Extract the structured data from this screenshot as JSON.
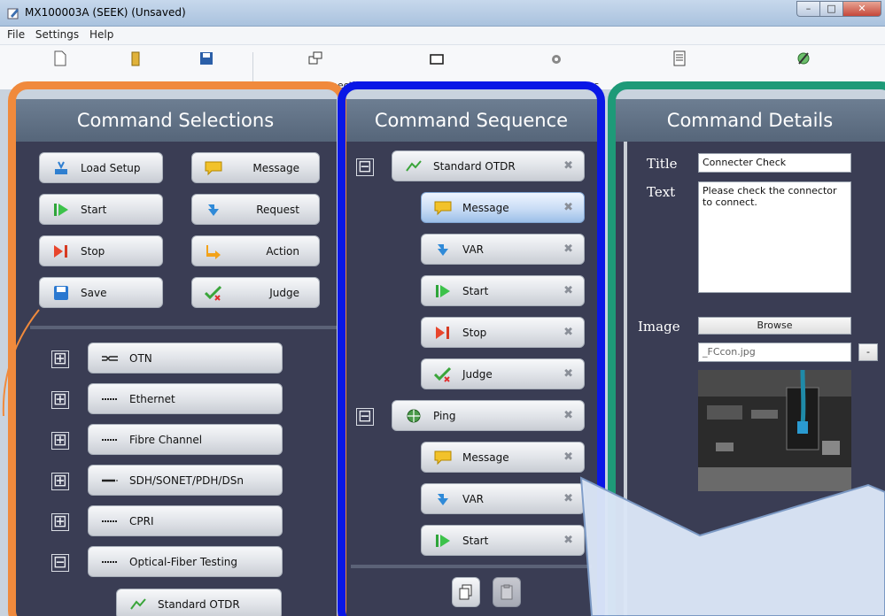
{
  "window": {
    "title": "MX100003A (SEEK) (Unsaved)",
    "min": "–",
    "max": "□",
    "close": "✕"
  },
  "menu": [
    "File",
    "Settings",
    "Help"
  ],
  "toolbar": [
    {
      "label": "New",
      "icon": "new-file-icon"
    },
    {
      "label": "Open",
      "icon": "open-folder-icon"
    },
    {
      "label": "Save",
      "icon": "save-icon"
    },
    {
      "label": "MT1000A Connection",
      "icon": "connection-icon"
    },
    {
      "label": "Instrument Configuration",
      "icon": "instrument-icon"
    },
    {
      "label": "Scenario Settings",
      "icon": "scenario-settings-icon"
    },
    {
      "label": "Report Settings",
      "icon": "report-settings-icon"
    },
    {
      "label": "Global Variables",
      "icon": "global-variables-icon"
    }
  ],
  "selections": {
    "title": "Command Selections",
    "commands": [
      {
        "label": "Load Setup",
        "icon": "load-setup-icon"
      },
      {
        "label": "Message",
        "icon": "message-icon"
      },
      {
        "label": "Start",
        "icon": "start-icon"
      },
      {
        "label": "Request",
        "icon": "request-icon"
      },
      {
        "label": "Stop",
        "icon": "stop-icon"
      },
      {
        "label": "Action",
        "icon": "action-icon"
      },
      {
        "label": "Save",
        "icon": "save-icon"
      },
      {
        "label": "Judge",
        "icon": "judge-icon"
      }
    ],
    "categories": [
      {
        "label": "OTN",
        "expander": "⊞"
      },
      {
        "label": "Ethernet",
        "expander": "⊞"
      },
      {
        "label": "Fibre Channel",
        "expander": "⊞"
      },
      {
        "label": "SDH/SONET/PDH/DSn",
        "expander": "⊞"
      },
      {
        "label": "CPRI",
        "expander": "⊞"
      },
      {
        "label": "Optical-Fiber Testing",
        "expander": "⊟"
      }
    ],
    "sub_item": "Standard OTDR"
  },
  "sequence": {
    "title": "Command Sequence",
    "groups": [
      {
        "label": "Standard OTDR",
        "items": [
          "Message",
          "VAR",
          "Start",
          "Stop",
          "Judge"
        ]
      },
      {
        "label": "Ping",
        "items": [
          "Message",
          "VAR",
          "Start"
        ]
      }
    ],
    "delete_glyph": "✖"
  },
  "details": {
    "title": "Command Details",
    "title_label": "Title",
    "title_value": "Connecter Check",
    "text_label": "Text",
    "text_value": "Please check the connector to connect.",
    "image_label": "Image",
    "browse_label": "Browse",
    "image_file": "_FCcon.jpg",
    "clear_label": "-"
  },
  "colors": {
    "selections_frame": "#f08a3c",
    "sequence_frame": "#0a17e6",
    "details_frame": "#1e9a78",
    "panel_bg": "#3a3d54",
    "header_bg": "#5f7085"
  }
}
